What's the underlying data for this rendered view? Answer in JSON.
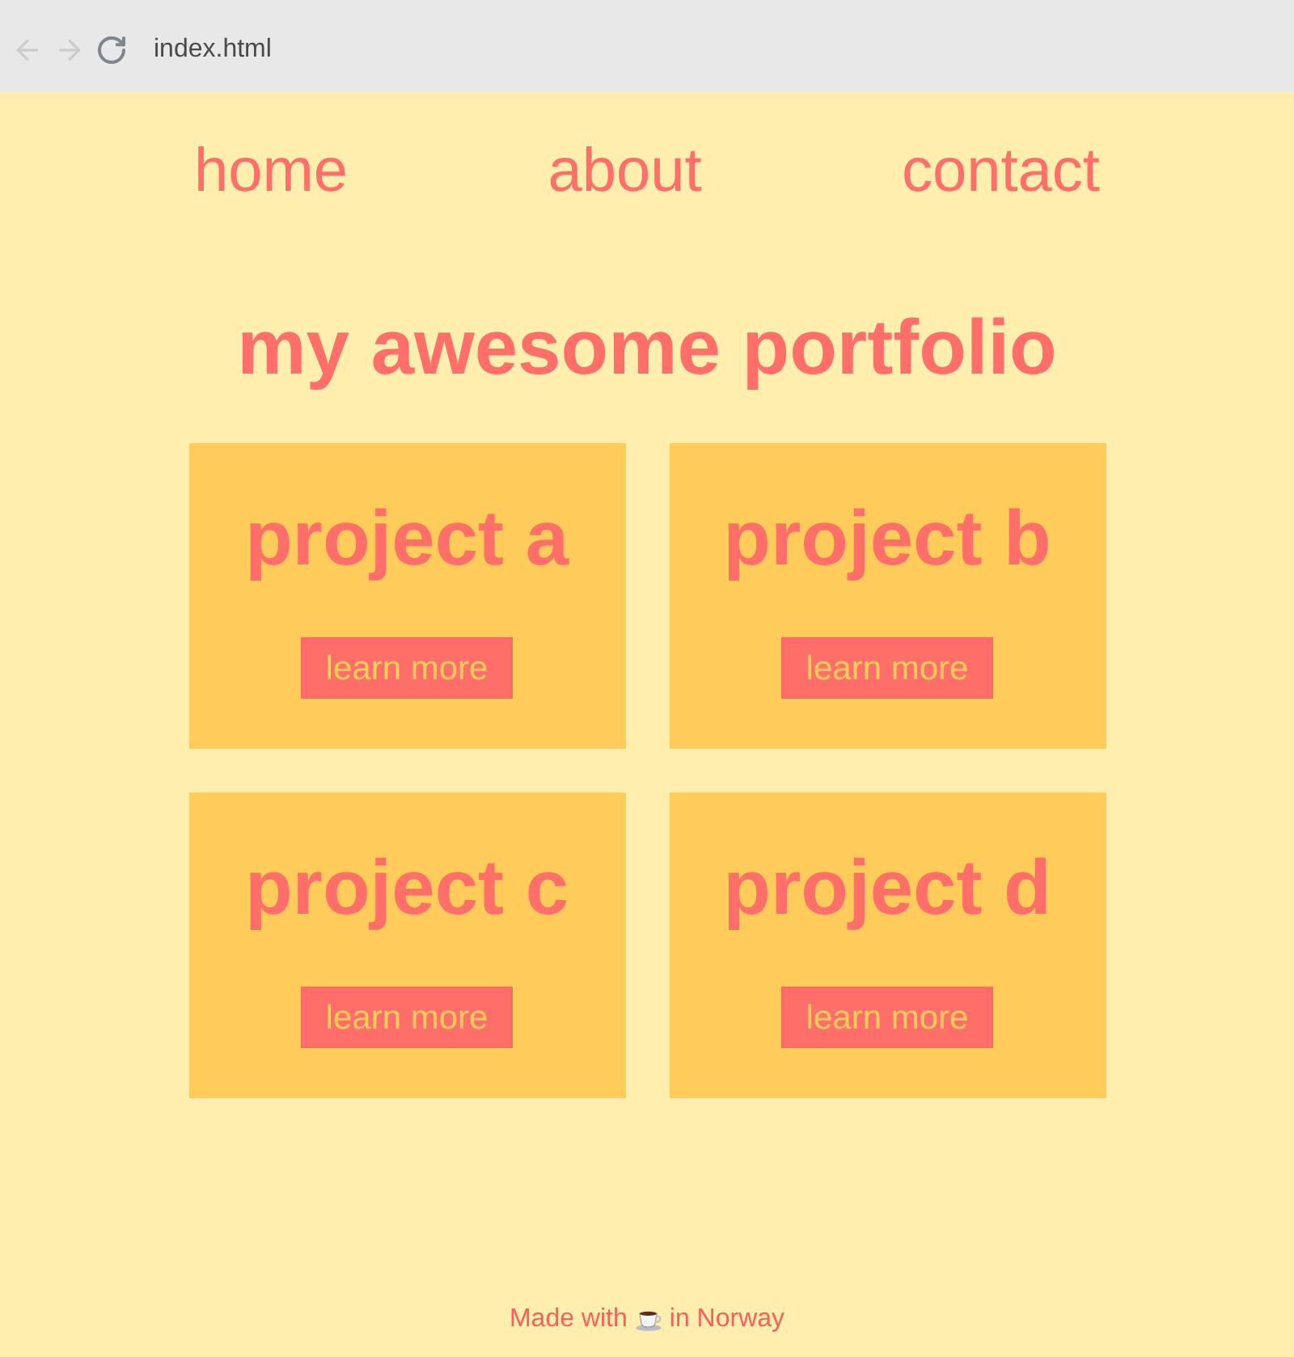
{
  "browser": {
    "back": {
      "disabled": true
    },
    "forward": {
      "disabled": true
    },
    "address": "index.html"
  },
  "nav": [
    {
      "label": "home"
    },
    {
      "label": "about"
    },
    {
      "label": "contact"
    }
  ],
  "heading": "my awesome portfolio",
  "projects": [
    {
      "title": "project a",
      "button": "learn more"
    },
    {
      "title": "project b",
      "button": "learn more"
    },
    {
      "title": "project c",
      "button": "learn more"
    },
    {
      "title": "project d",
      "button": "learn more"
    }
  ],
  "footer": {
    "text_before": "Made with",
    "text_after": "in Norway"
  }
}
